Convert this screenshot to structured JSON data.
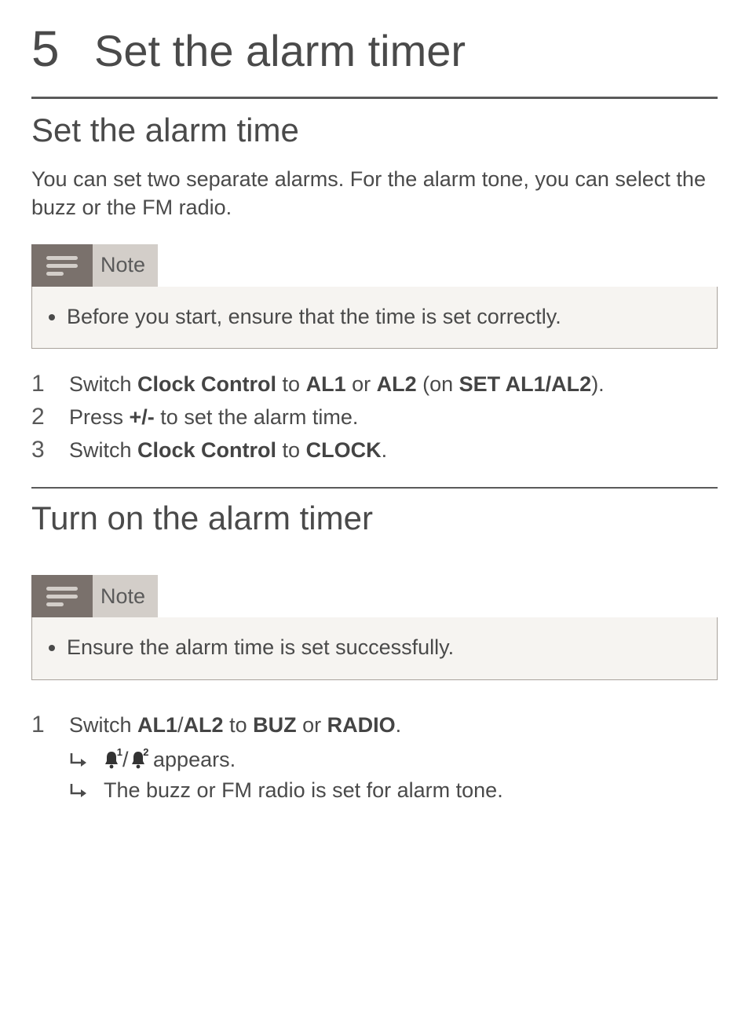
{
  "chapter": {
    "number": "5",
    "title": "Set the alarm timer"
  },
  "section1": {
    "heading": "Set the alarm time",
    "intro": "You can set two separate alarms. For the alarm tone, you can select the buzz or the FM radio.",
    "note_label": "Note",
    "note_item": "Before you start, ensure that the time is set correctly.",
    "steps": [
      {
        "num": "1",
        "pre": "Switch ",
        "b1": "Clock Control",
        "mid1": " to ",
        "b2": "AL1",
        "mid2": " or ",
        "b3": "AL2",
        "mid3": " (on ",
        "b4": "SET AL1/AL2",
        "post": ")."
      },
      {
        "num": "2",
        "pre": "Press ",
        "b1": "+/-",
        "post": " to set the alarm time."
      },
      {
        "num": "3",
        "pre": "Switch ",
        "b1": "Clock Control",
        "mid1": " to ",
        "b2": "CLOCK",
        "post": "."
      }
    ]
  },
  "section2": {
    "heading": "Turn on the alarm timer",
    "note_label": "Note",
    "note_item": "Ensure the alarm time is set successfully.",
    "step": {
      "num": "1",
      "pre": "Switch ",
      "b1": "AL1",
      "slash1": "/",
      "b2": "AL2",
      "mid": " to ",
      "b3": "BUZ",
      "mid2": " or ",
      "b4": "RADIO",
      "post": "."
    },
    "results": {
      "r1_post": " appears.",
      "r2": "The buzz or FM radio is set for alarm tone.",
      "bell1_badge": "1",
      "bell2_badge": "2",
      "bell_slash": "/"
    }
  }
}
